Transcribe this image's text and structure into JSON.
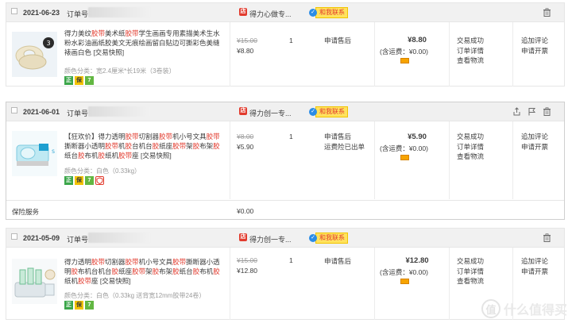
{
  "orders": [
    {
      "date": "2021-06-23",
      "order_label": "订单号:",
      "shop": "得力心做专...",
      "contact": "和我联系",
      "title_parts": [
        {
          "t": "得力美纹",
          "red": false
        },
        {
          "t": "胶带",
          "red": true
        },
        {
          "t": "美术纸",
          "red": false
        },
        {
          "t": "胶带",
          "red": true
        },
        {
          "t": "学生画画专用素描美术生水粉水彩油画纸胶美文无痕绘画留白贴边可撕彩色美缝裱画白色 [交易快照]",
          "red": false
        }
      ],
      "spec": "颜色分类：宽2.4厘米*长19米（3卷装）",
      "badges": [
        "正",
        "保",
        "7"
      ],
      "orig_price": "¥15.00",
      "price": "¥8.80",
      "qty": "1",
      "after": [
        "申请售后"
      ],
      "total": "¥8.80",
      "ship": "(含运费：¥0.00)",
      "status": [
        "交易成功",
        "订单详情",
        "查看物流"
      ],
      "actions": [
        "追加评论",
        "申请开票"
      ]
    },
    {
      "date": "2021-06-01",
      "order_label": "订单号:",
      "shop": "得力创一专...",
      "contact": "和我联系",
      "title_parts": [
        {
          "t": "【狂欢价】得力透明",
          "red": false
        },
        {
          "t": "胶带",
          "red": true
        },
        {
          "t": "切割器",
          "red": false
        },
        {
          "t": "胶带",
          "red": true
        },
        {
          "t": "机小号文具",
          "red": false
        },
        {
          "t": "胶带",
          "red": true
        },
        {
          "t": "撕断器小透明",
          "red": false
        },
        {
          "t": "胶带",
          "red": true
        },
        {
          "t": "机",
          "red": false
        },
        {
          "t": "胶",
          "red": true
        },
        {
          "t": "台机台",
          "red": false
        },
        {
          "t": "胶",
          "red": true
        },
        {
          "t": "纸座",
          "red": false
        },
        {
          "t": "胶带",
          "red": true
        },
        {
          "t": "架",
          "red": false
        },
        {
          "t": "胶",
          "red": true
        },
        {
          "t": "布架",
          "red": false
        },
        {
          "t": "胶",
          "red": true
        },
        {
          "t": "纸台",
          "red": false
        },
        {
          "t": "胶",
          "red": true
        },
        {
          "t": "布机",
          "red": false
        },
        {
          "t": "胶",
          "red": true
        },
        {
          "t": "纸机",
          "red": false
        },
        {
          "t": "胶带",
          "red": true
        },
        {
          "t": "座 [交易快照]",
          "red": false
        }
      ],
      "spec": "颜色分类：白色（0.33kg）",
      "badges": [
        "正",
        "保",
        "7",
        "盾"
      ],
      "orig_price": "¥8.00",
      "price": "¥5.90",
      "qty": "1",
      "after": [
        "申请售后",
        "运费险已出单"
      ],
      "total": "¥5.90",
      "ship": "(含运费：¥0.00)",
      "status": [
        "交易成功",
        "订单详情",
        "查看物流"
      ],
      "actions": [
        "追加评论",
        "申请开票"
      ],
      "service": {
        "label": "保险服务",
        "amount": "¥0.00"
      }
    },
    {
      "date": "2021-05-09",
      "order_label": "订单号:",
      "shop": "得力创一专...",
      "contact": "和我联系",
      "title_parts": [
        {
          "t": "得力透明",
          "red": false
        },
        {
          "t": "胶带",
          "red": true
        },
        {
          "t": "切割器",
          "red": false
        },
        {
          "t": "胶带",
          "red": true
        },
        {
          "t": "机小号文具",
          "red": false
        },
        {
          "t": "胶带",
          "red": true
        },
        {
          "t": "撕断器小透明",
          "red": false
        },
        {
          "t": "胶",
          "red": true
        },
        {
          "t": "布机台机台",
          "red": false
        },
        {
          "t": "胶",
          "red": true
        },
        {
          "t": "纸座",
          "red": false
        },
        {
          "t": "胶带",
          "red": true
        },
        {
          "t": "架",
          "red": false
        },
        {
          "t": "胶",
          "red": true
        },
        {
          "t": "布架",
          "red": false
        },
        {
          "t": "胶",
          "red": true
        },
        {
          "t": "纸台",
          "red": false
        },
        {
          "t": "胶",
          "red": true
        },
        {
          "t": "布机",
          "red": false
        },
        {
          "t": "胶",
          "red": true
        },
        {
          "t": "纸机",
          "red": false
        },
        {
          "t": "胶带",
          "red": true
        },
        {
          "t": "座 [交易快照]",
          "red": false
        }
      ],
      "spec": "颜色分类：白色（0.33kg 送背宽12mm胶带24卷）",
      "badges": [
        "正",
        "保",
        "7"
      ],
      "orig_price": "¥15.00",
      "price": "¥12.80",
      "qty": "1",
      "after": [
        "申请售后"
      ],
      "total": "¥12.80",
      "ship": "(含运费：¥0.00)",
      "status": [
        "交易成功",
        "订单详情",
        "查看物流"
      ],
      "actions": [
        "追加评论",
        "申请开票"
      ]
    }
  ],
  "watermark": "什么值得买",
  "colors": {
    "accent_red": "#e23b2e",
    "contact_yellow": "#ffe25e",
    "contact_blue": "#2a8ce6"
  }
}
